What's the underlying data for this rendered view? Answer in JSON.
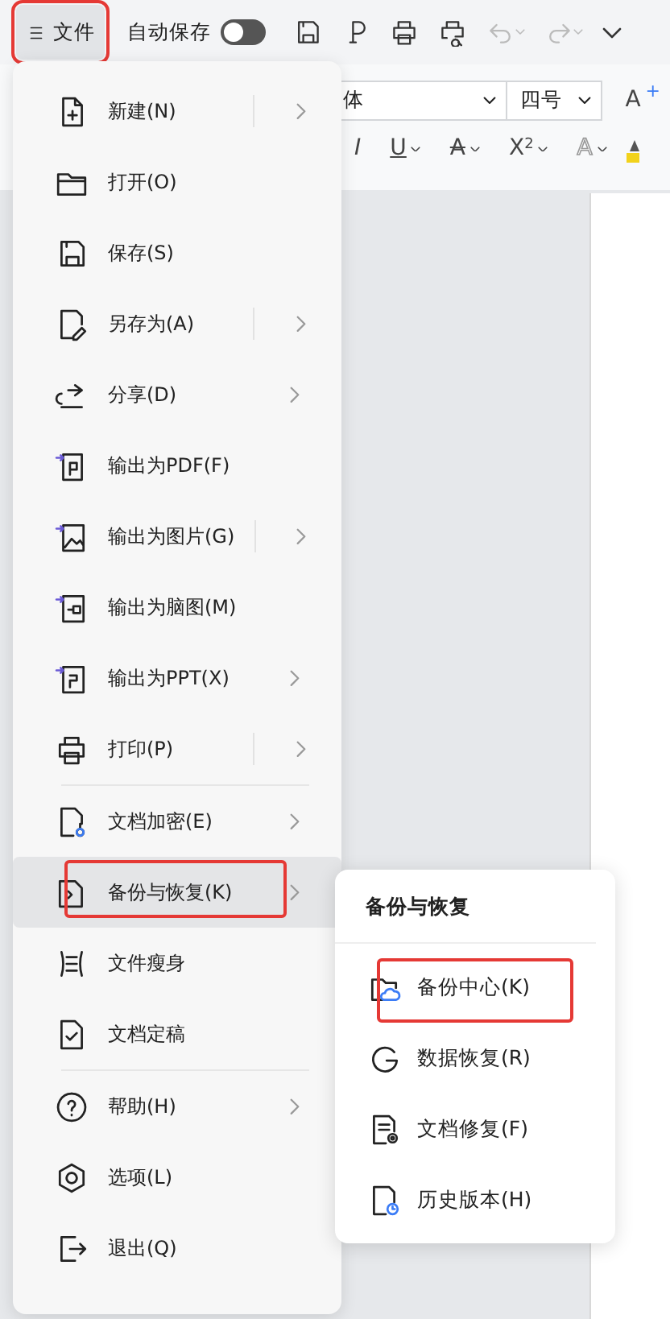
{
  "file_button": {
    "label": "文件",
    "highlighted": true
  },
  "auto_save": {
    "label": "自动保存",
    "on": false
  },
  "quick_tools": [
    {
      "kind": "save",
      "disabled": false
    },
    {
      "kind": "pin",
      "disabled": false
    },
    {
      "kind": "print",
      "disabled": false
    },
    {
      "kind": "preview",
      "disabled": false
    },
    {
      "kind": "undo",
      "disabled": true
    },
    {
      "kind": "redo",
      "disabled": true
    },
    {
      "kind": "more",
      "disabled": false
    }
  ],
  "ribbon": {
    "font_name": "体",
    "font_size": "四号",
    "grow_font": "A$^{+}$",
    "format_buttons": [
      {
        "kind": "italic",
        "label": "I"
      },
      {
        "kind": "underline",
        "label": "U"
      },
      {
        "kind": "strike",
        "label": "A"
      },
      {
        "kind": "superscript",
        "label": "X$^{2}$"
      },
      {
        "kind": "outline",
        "label": "A"
      }
    ]
  },
  "file_menu": {
    "sections": [
      {
        "items": [
          {
            "label": "新建(N)",
            "submenu": true,
            "split": true,
            "selected": false,
            "highlighted": false
          },
          {
            "label": "打开(O)",
            "submenu": false,
            "split": false,
            "selected": false,
            "highlighted": false
          },
          {
            "label": "保存(S)",
            "submenu": false,
            "split": false,
            "selected": false,
            "highlighted": false
          },
          {
            "label": "另存为(A)",
            "submenu": true,
            "split": true,
            "selected": false,
            "highlighted": false
          },
          {
            "label": "分享(D)",
            "submenu": true,
            "split": false,
            "selected": false,
            "highlighted": false
          },
          {
            "label": "输出为PDF(F)",
            "submenu": false,
            "split": false,
            "selected": false,
            "highlighted": false
          },
          {
            "label": "输出为图片(G)",
            "submenu": true,
            "split": true,
            "selected": false,
            "highlighted": false
          },
          {
            "label": "输出为脑图(M)",
            "submenu": false,
            "split": false,
            "selected": false,
            "highlighted": false
          },
          {
            "label": "输出为PPT(X)",
            "submenu": true,
            "split": false,
            "selected": false,
            "highlighted": false
          },
          {
            "label": "打印(P)",
            "submenu": true,
            "split": true,
            "selected": false,
            "highlighted": false
          }
        ]
      },
      {
        "items": [
          {
            "label": "文档加密(E)",
            "submenu": true,
            "split": false,
            "selected": false,
            "highlighted": false
          },
          {
            "label": "备份与恢复(K)",
            "submenu": true,
            "split": false,
            "selected": true,
            "highlighted": true
          },
          {
            "label": "文件瘦身",
            "submenu": false,
            "split": false,
            "selected": false,
            "highlighted": false
          },
          {
            "label": "文档定稿",
            "submenu": false,
            "split": false,
            "selected": false,
            "highlighted": false
          }
        ]
      },
      {
        "items": [
          {
            "label": "帮助(H)",
            "submenu": true,
            "split": false,
            "selected": false,
            "highlighted": false
          },
          {
            "label": "选项(L)",
            "submenu": false,
            "split": false,
            "selected": false,
            "highlighted": false
          },
          {
            "label": "退出(Q)",
            "submenu": false,
            "split": false,
            "selected": false,
            "highlighted": false
          }
        ]
      }
    ]
  },
  "submenu": {
    "title": "备份与恢复",
    "items": [
      {
        "label": "备份中心(K)",
        "highlighted": true
      },
      {
        "label": "数据恢复(R)",
        "highlighted": false
      },
      {
        "label": "文档修复(F)",
        "highlighted": false
      },
      {
        "label": "历史版本(H)",
        "highlighted": false
      }
    ]
  }
}
